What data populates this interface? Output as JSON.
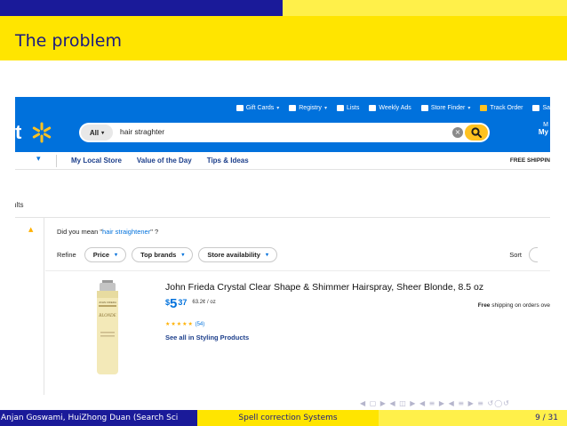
{
  "slide": {
    "title": "The problem",
    "footer_left": "Anjan Goswami, HuiZhong Duan (Search Sci",
    "footer_center": "Spell correction Systems",
    "footer_right": "9 / 31",
    "nav_symbols": "◀ ▢ ▶ ◀ ◫ ▶ ◀ ≡ ▶ ◀ ≡ ▶ ≡ ↺◯↺"
  },
  "walmart": {
    "logo_text": "t",
    "top_links": [
      {
        "label": "Gift Cards",
        "caret": "▾",
        "icon": "gift-card-icon"
      },
      {
        "label": "Registry",
        "caret": "▾",
        "icon": "registry-icon"
      },
      {
        "label": "Lists",
        "caret": "",
        "icon": "list-icon"
      },
      {
        "label": "Weekly Ads",
        "caret": "",
        "icon": "weekly-ads-icon"
      },
      {
        "label": "Store Finder",
        "caret": "▾",
        "icon": "location-pin-icon"
      },
      {
        "label": "Track Order",
        "caret": "",
        "icon": "track-order-icon"
      },
      {
        "label": "Sa",
        "caret": "",
        "icon": "store-icon"
      }
    ],
    "account": {
      "line1": "M",
      "line2": "My"
    },
    "search": {
      "department": "All",
      "department_caret": "▾",
      "query": "hair straghter",
      "clear_glyph": "×"
    },
    "nav": {
      "chevron": "▾",
      "links": [
        "My Local Store",
        "Value of the Day",
        "Tips & Ideas"
      ],
      "shipping": "FREE SHIPPIN"
    },
    "results_label": "ults",
    "left_chevron": "▲",
    "did_you_mean": {
      "prefix": "Did you mean \"",
      "suggestion": "hair straightener",
      "suffix": "\" ?"
    },
    "refine": {
      "label": "Refine",
      "filters": [
        {
          "label": "Price",
          "caret": "▾"
        },
        {
          "label": "Top brands",
          "caret": "▾"
        },
        {
          "label": "Store availability",
          "caret": "▾"
        }
      ]
    },
    "sort_label": "Sort",
    "product": {
      "title": "John Frieda Crystal Clear Shape & Shimmer Hairspray, Sheer Blonde, 8.5 oz",
      "price_currency": "$",
      "price_dollars": "5",
      "price_cents": "37",
      "unit_price": "63.2¢ / oz",
      "stars": "★★★★★",
      "review_count": "(54)",
      "see_all": "See all in Styling Products",
      "free_shipping_bold": "Free",
      "free_shipping_rest": " shipping on orders ove",
      "can_label": "BLONDE",
      "can_brand": "JOHN FRIEDA"
    }
  },
  "colors": {
    "beamer_navy": "#1a1a99",
    "beamer_yellow": "#ffe500",
    "walmart_blue": "#0071dc",
    "walmart_yellow": "#ffc220"
  }
}
